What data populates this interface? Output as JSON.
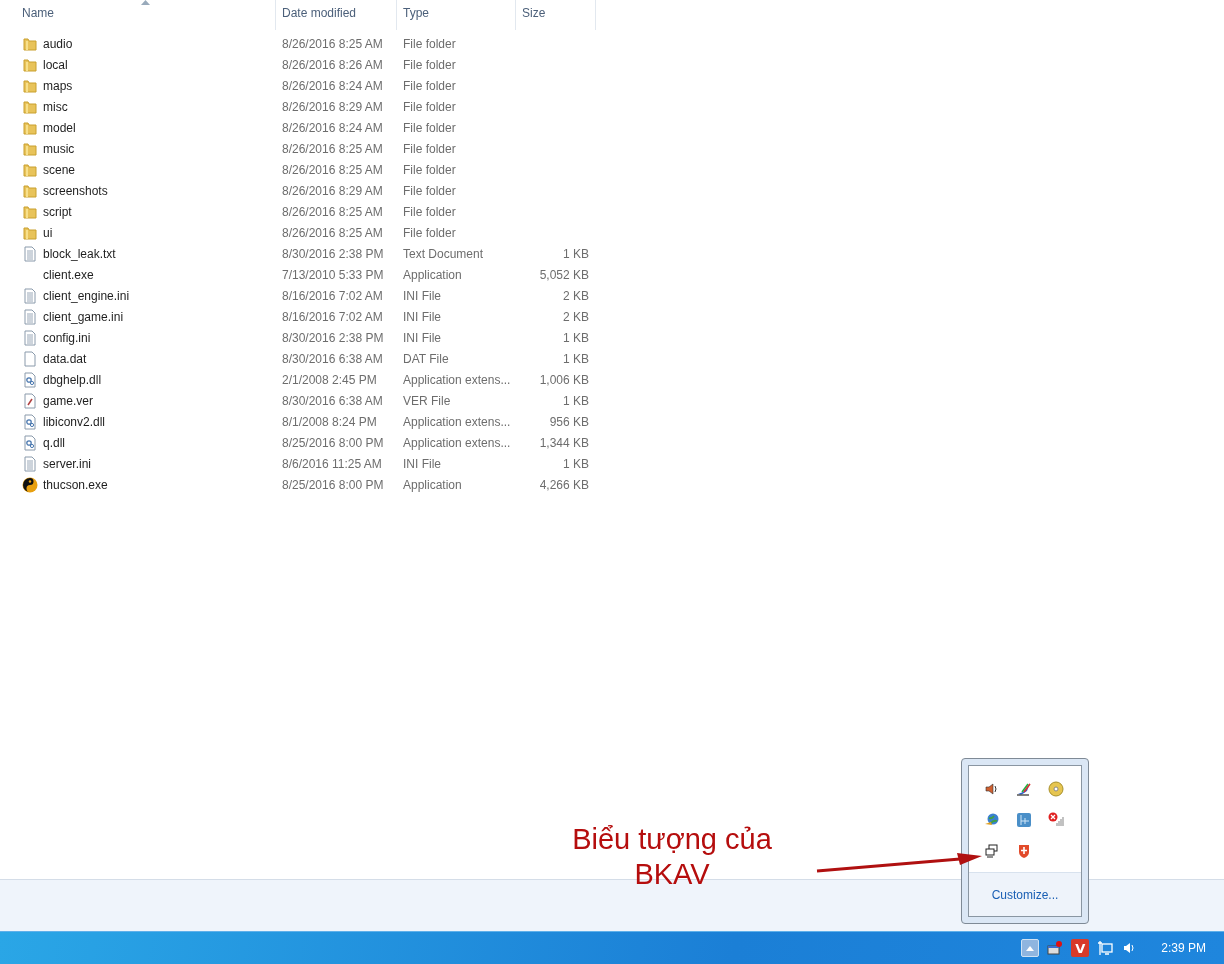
{
  "columns": [
    {
      "label": "Name",
      "sorted": true
    },
    {
      "label": "Date modified",
      "sorted": false
    },
    {
      "label": "Type",
      "sorted": false
    },
    {
      "label": "Size",
      "sorted": false
    }
  ],
  "files": [
    {
      "kind": "folder",
      "name": "audio",
      "date": "8/26/2016 8:25 AM",
      "type": "File folder"
    },
    {
      "kind": "folder",
      "name": "local",
      "date": "8/26/2016 8:26 AM",
      "type": "File folder"
    },
    {
      "kind": "folder",
      "name": "maps",
      "date": "8/26/2016 8:24 AM",
      "type": "File folder"
    },
    {
      "kind": "folder",
      "name": "misc",
      "date": "8/26/2016 8:29 AM",
      "type": "File folder"
    },
    {
      "kind": "folder",
      "name": "model",
      "date": "8/26/2016 8:24 AM",
      "type": "File folder"
    },
    {
      "kind": "folder",
      "name": "music",
      "date": "8/26/2016 8:25 AM",
      "type": "File folder"
    },
    {
      "kind": "folder",
      "name": "scene",
      "date": "8/26/2016 8:25 AM",
      "type": "File folder"
    },
    {
      "kind": "folder",
      "name": "screenshots",
      "date": "8/26/2016 8:29 AM",
      "type": "File folder"
    },
    {
      "kind": "folder",
      "name": "script",
      "date": "8/26/2016 8:25 AM",
      "type": "File folder"
    },
    {
      "kind": "folder",
      "name": "ui",
      "date": "8/26/2016 8:25 AM",
      "type": "File folder"
    },
    {
      "kind": "text",
      "name": "block_leak.txt",
      "date": "8/30/2016 2:38 PM",
      "type": "Text Document",
      "size": "1 KB"
    },
    {
      "kind": "none",
      "name": "client.exe",
      "date": "7/13/2010 5:33 PM",
      "type": "Application",
      "size": "5,052 KB"
    },
    {
      "kind": "text",
      "name": "client_engine.ini",
      "date": "8/16/2016 7:02 AM",
      "type": "INI File",
      "size": "2 KB"
    },
    {
      "kind": "text",
      "name": "client_game.ini",
      "date": "8/16/2016 7:02 AM",
      "type": "INI File",
      "size": "2 KB"
    },
    {
      "kind": "text",
      "name": "config.ini",
      "date": "8/30/2016 2:38 PM",
      "type": "INI File",
      "size": "1 KB"
    },
    {
      "kind": "blank",
      "name": "data.dat",
      "date": "8/30/2016 6:38 AM",
      "type": "DAT File",
      "size": "1 KB"
    },
    {
      "kind": "dll",
      "name": "dbghelp.dll",
      "date": "2/1/2008 2:45 PM",
      "type": "Application extens...",
      "size": "1,006 KB"
    },
    {
      "kind": "ver",
      "name": "game.ver",
      "date": "8/30/2016 6:38 AM",
      "type": "VER File",
      "size": "1 KB"
    },
    {
      "kind": "dll",
      "name": "libiconv2.dll",
      "date": "8/1/2008 8:24 PM",
      "type": "Application extens...",
      "size": "956 KB"
    },
    {
      "kind": "dll",
      "name": "q.dll",
      "date": "8/25/2016 8:00 PM",
      "type": "Application extens...",
      "size": "1,344 KB"
    },
    {
      "kind": "text",
      "name": "server.ini",
      "date": "8/6/2016 11:25 AM",
      "type": "INI File",
      "size": "1 KB"
    },
    {
      "kind": "yinyang",
      "name": "thucson.exe",
      "date": "8/25/2016 8:00 PM",
      "type": "Application",
      "size": "4,266 KB"
    }
  ],
  "tray_popup": {
    "customize": "Customize..."
  },
  "annotation": {
    "lines": [
      "Biểu tượng của",
      "BKAV"
    ]
  },
  "taskbar": {
    "app_badge": "V",
    "clock": "2:39 PM"
  }
}
